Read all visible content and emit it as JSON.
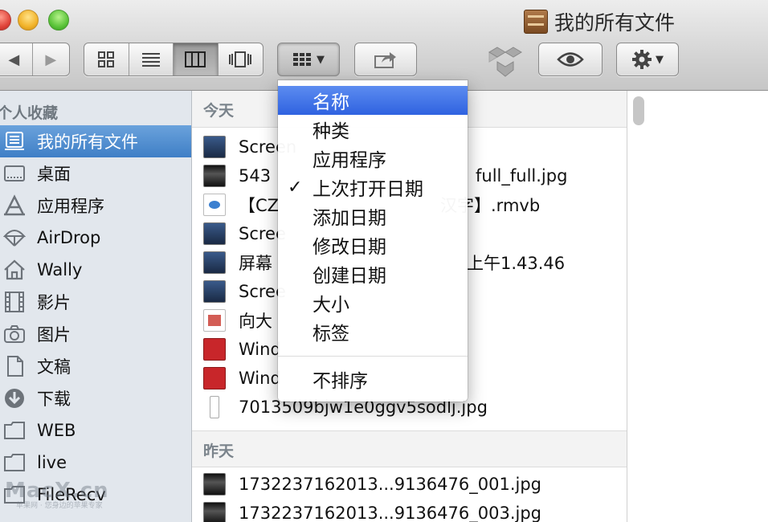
{
  "window": {
    "title": "我的所有文件"
  },
  "toolbar": {
    "nav": {
      "back": "◀",
      "forward": "▶"
    },
    "views": [
      {
        "name": "icon-view",
        "active": false
      },
      {
        "name": "list-view",
        "active": false
      },
      {
        "name": "column-view",
        "active": true
      },
      {
        "name": "coverflow-view",
        "active": false
      }
    ],
    "arrange_icon": "grid-icon",
    "share_icon": "share-icon",
    "quicklook_icon": "eye-icon",
    "action_icon": "gear-icon"
  },
  "sidebar": {
    "header": "个人收藏",
    "items": [
      {
        "label": "我的所有文件",
        "icon": "all-files-icon",
        "selected": true
      },
      {
        "label": "桌面",
        "icon": "desktop-icon"
      },
      {
        "label": "应用程序",
        "icon": "applications-icon"
      },
      {
        "label": "AirDrop",
        "icon": "airdrop-icon"
      },
      {
        "label": "Wally",
        "icon": "home-icon"
      },
      {
        "label": "影片",
        "icon": "movies-icon"
      },
      {
        "label": "图片",
        "icon": "camera-icon"
      },
      {
        "label": "文稿",
        "icon": "documents-icon"
      },
      {
        "label": "下载",
        "icon": "downloads-icon"
      },
      {
        "label": "WEB",
        "icon": "folder-icon"
      },
      {
        "label": "live",
        "icon": "folder-icon"
      },
      {
        "label": "FileRecv",
        "icon": "folder-icon"
      }
    ]
  },
  "files": {
    "groups": [
      {
        "title": "今天",
        "items": [
          {
            "name": "Screen",
            "icon": "shot"
          },
          {
            "name": "543",
            "suffix": "full_full.jpg",
            "icon": "img"
          },
          {
            "name": "【CZ",
            "suffix": "汉字】.rmvb",
            "icon": "media"
          },
          {
            "name": "Scree",
            "icon": "shot"
          },
          {
            "name": "屏幕",
            "suffix": "上午1.43.46",
            "icon": "shot"
          },
          {
            "name": "Scree",
            "icon": "shot"
          },
          {
            "name": "向大",
            "icon": "doc"
          },
          {
            "name": "Wind",
            "icon": "par"
          },
          {
            "name": "Wind",
            "icon": "par"
          },
          {
            "name": "7013509bjw1e0ggv5sodlj.jpg",
            "icon": "thin"
          }
        ]
      },
      {
        "title": "昨天",
        "items": [
          {
            "name": "1732237162013...9136476_001.jpg",
            "icon": "img"
          },
          {
            "name": "1732237162013...9136476_003.jpg",
            "icon": "img"
          }
        ]
      }
    ]
  },
  "sort_menu": {
    "items": [
      {
        "label": "名称",
        "selected": true,
        "checked": false
      },
      {
        "label": "种类"
      },
      {
        "label": "应用程序"
      },
      {
        "label": "上次打开日期",
        "checked": true
      },
      {
        "label": "添加日期"
      },
      {
        "label": "修改日期"
      },
      {
        "label": "创建日期"
      },
      {
        "label": "大小"
      },
      {
        "label": "标签"
      }
    ],
    "none_label": "不排序",
    "check_glyph": "✓"
  },
  "watermark": {
    "brand": "MacX.cn",
    "tagline": "苹果网 · 您身边的苹果专家"
  }
}
